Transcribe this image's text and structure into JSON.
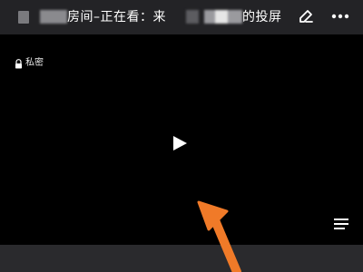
{
  "header": {
    "title_part1": "房间–正在看：来",
    "title_part2": "的投屏",
    "back_icon": "back-icon",
    "edit_icon": "edit-icon",
    "more_icon": "more-icon"
  },
  "video": {
    "private_label": "私密",
    "lock_icon": "lock-icon",
    "play_icon": "play-icon",
    "menu_icon": "menu-icon"
  },
  "annotation": {
    "arrow_color": "#f07a28"
  },
  "colors": {
    "topbar": "#232326",
    "background": "#000000",
    "bottombar": "#2a2a2d"
  }
}
